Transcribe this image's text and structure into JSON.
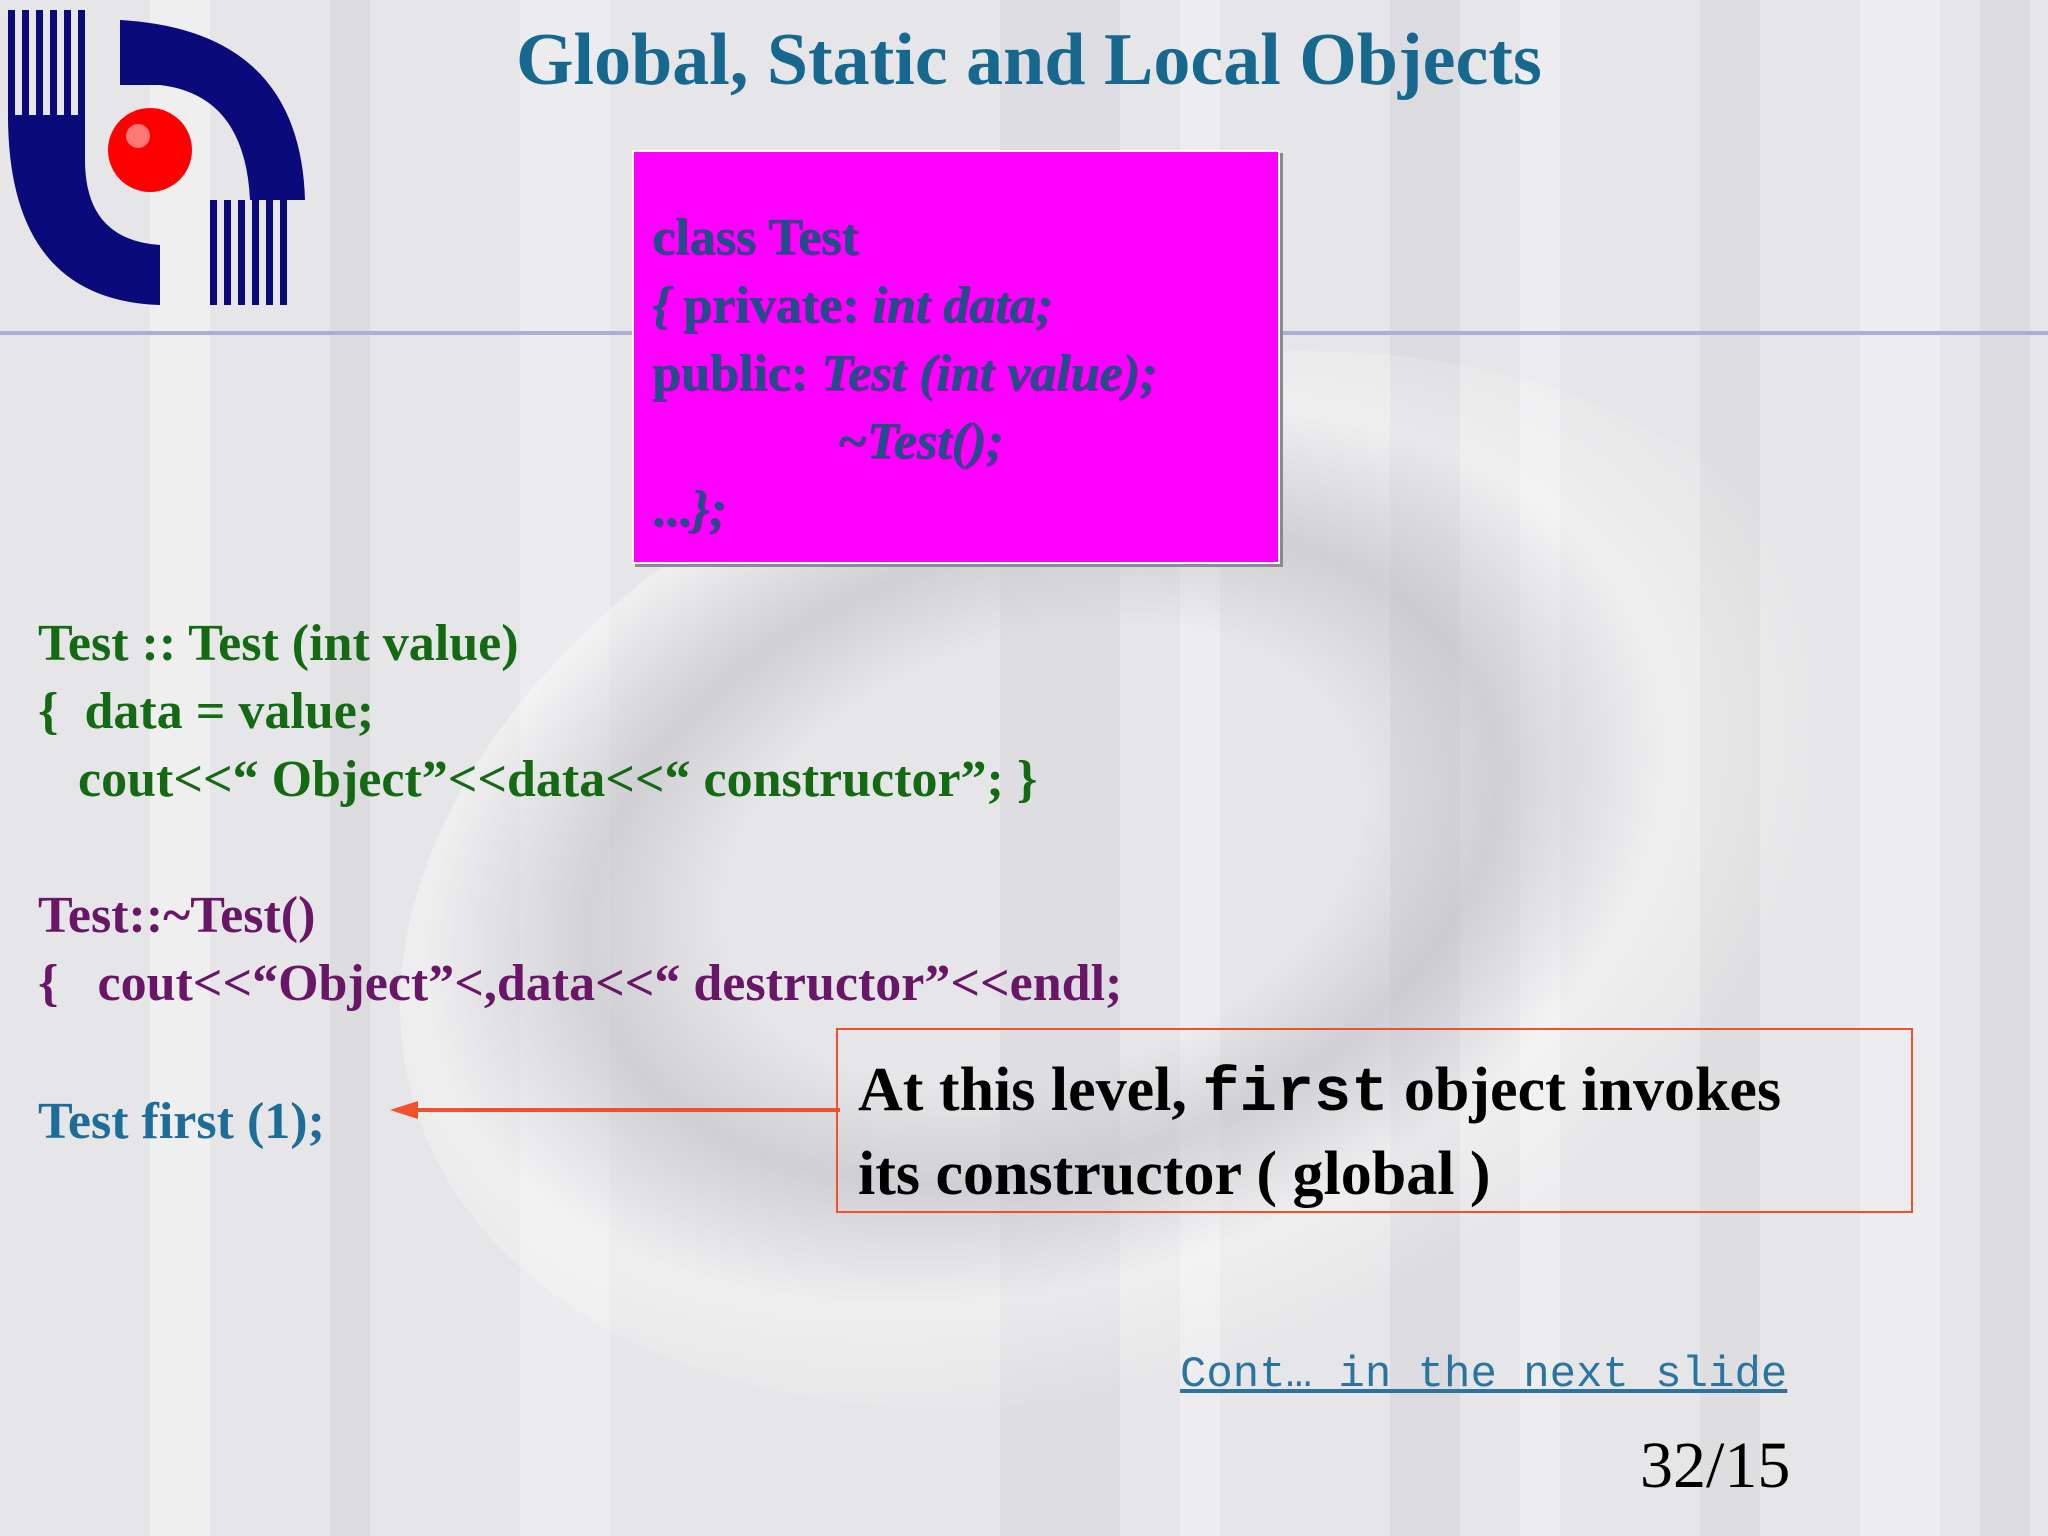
{
  "title": "Global, Static and Local Objects",
  "class_box": {
    "line1": "class Test",
    "line2_a": "{ ",
    "line2_b": "private: ",
    "line2_c": "int data;",
    "line3_a": "public:  ",
    "line3_b": "Test (int value);",
    "line4": "~Test();",
    "line5_a": "...",
    "line5_b": "};"
  },
  "constructor_code": {
    "line1": "Test :: Test (int value)",
    "line2": "{  data = value;",
    "line3": "  cout<<“ Object”<<data<<“ constructor”; }"
  },
  "destructor_code": {
    "line1": "Test::~Test()",
    "line2": "{   cout<<“Object”<,data<<“ destructor”<<endl;"
  },
  "object_decl": "Test first (1);",
  "callout": {
    "pre": "At this level, ",
    "keyword": "first",
    "post": " object invokes",
    "line2": "its constructor ( global )"
  },
  "continue_link": "Cont… in the next slide",
  "page_number": "32/15",
  "colors": {
    "title": "#17688f",
    "class_box_bg": "#ff00ff",
    "constructor": "#136a13",
    "destructor": "#6a1668",
    "declaration": "#1e6d99",
    "arrow": "#f0512a",
    "logo_navy": "#0a0a7a",
    "logo_red": "#ff0000"
  }
}
